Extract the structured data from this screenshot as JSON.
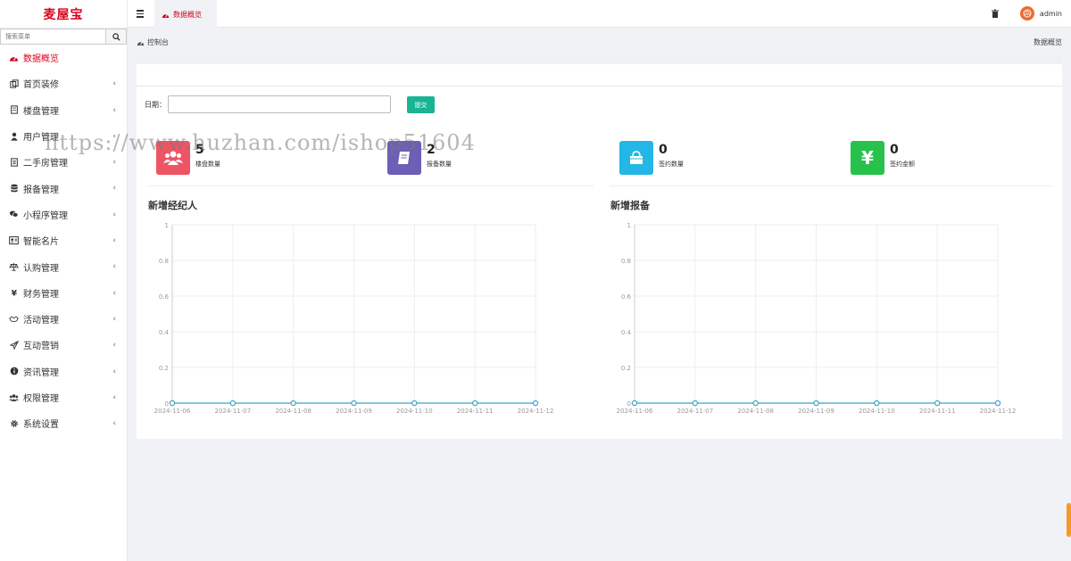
{
  "app": {
    "logo": "麦屋宝"
  },
  "sidebar": {
    "search_placeholder": "搜索菜单",
    "items": [
      {
        "label": "数据概览",
        "icon": "dashboard-icon",
        "active": true,
        "has_caret": false
      },
      {
        "label": "首页装修",
        "icon": "copy-icon",
        "has_caret": true
      },
      {
        "label": "楼盘管理",
        "icon": "building-icon",
        "has_caret": true
      },
      {
        "label": "用户管理",
        "icon": "user-icon",
        "has_caret": true
      },
      {
        "label": "二手房管理",
        "icon": "document-icon",
        "has_caret": true
      },
      {
        "label": "报备管理",
        "icon": "database-icon",
        "has_caret": true
      },
      {
        "label": "小程序管理",
        "icon": "wechat-icon",
        "has_caret": true
      },
      {
        "label": "智能名片",
        "icon": "id-card-icon",
        "has_caret": true
      },
      {
        "label": "认购管理",
        "icon": "balance-icon",
        "has_caret": true
      },
      {
        "label": "财务管理",
        "icon": "yen-icon",
        "has_caret": true
      },
      {
        "label": "活动管理",
        "icon": "handshake-icon",
        "has_caret": true
      },
      {
        "label": "互动营销",
        "icon": "paper-plane-icon",
        "has_caret": true
      },
      {
        "label": "资讯管理",
        "icon": "info-icon",
        "has_caret": true
      },
      {
        "label": "权限管理",
        "icon": "users-icon",
        "has_caret": true
      },
      {
        "label": "系统设置",
        "icon": "gear-icon",
        "has_caret": true
      }
    ]
  },
  "topbar": {
    "active_tab": "数据概览",
    "username": "admin"
  },
  "breadcrumb": {
    "left": "控制台",
    "right": "数据概览"
  },
  "filter": {
    "date_label": "日期：",
    "date_value": "",
    "submit_label": "提交"
  },
  "stats": [
    {
      "value": "5",
      "label": "楼盘数量",
      "color": "#ed5565",
      "icon": "users-icon"
    },
    {
      "value": "2",
      "label": "报备数量",
      "color": "#6c5fb5",
      "icon": "book-icon"
    },
    {
      "value": "0",
      "label": "签约数量",
      "color": "#23b7e5",
      "icon": "shopping-bag-icon"
    },
    {
      "value": "0",
      "label": "签约金额",
      "color": "#27c24c",
      "icon": "yen-icon"
    }
  ],
  "watermark": "https://www.huzhan.com/ishop51604",
  "chart_data": [
    {
      "type": "line",
      "title": "新增经纪人",
      "x": [
        "2024-11-06",
        "2024-11-07",
        "2024-11-08",
        "2024-11-09",
        "2024-11-10",
        "2024-11-11",
        "2024-11-12"
      ],
      "series": [
        {
          "values": [
            0,
            0,
            0,
            0,
            0,
            0,
            0
          ]
        }
      ],
      "yticks": [
        "0",
        "0.2",
        "0.4",
        "0.6",
        "0.8",
        "1"
      ],
      "ylim": [
        0,
        1
      ],
      "grid": true,
      "color": "#3aa3c5"
    },
    {
      "type": "line",
      "title": "新增报备",
      "x": [
        "2024-11-06",
        "2024-11-07",
        "2024-11-08",
        "2024-11-09",
        "2024-11-10",
        "2024-11-11",
        "2024-11-12"
      ],
      "series": [
        {
          "values": [
            0,
            0,
            0,
            0,
            0,
            0,
            0
          ]
        }
      ],
      "yticks": [
        "0",
        "0.2",
        "0.4",
        "0.6",
        "0.8",
        "1"
      ],
      "ylim": [
        0,
        1
      ],
      "grid": true,
      "color": "#3aa3c5"
    }
  ]
}
